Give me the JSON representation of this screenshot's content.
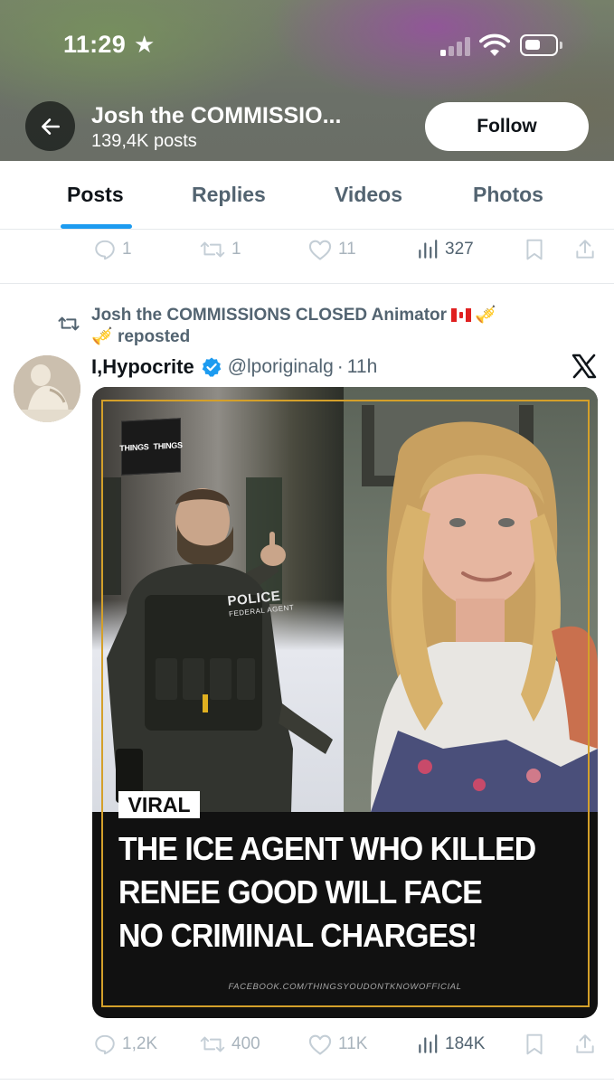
{
  "status_bar": {
    "time": "11:29",
    "star_glyph": "★"
  },
  "header": {
    "name": "Josh the COMMISSIO...",
    "post_count": "139,4K posts",
    "follow_label": "Follow",
    "back_icon": "arrow-left-icon"
  },
  "tabs": [
    {
      "label": "Posts",
      "active": true
    },
    {
      "label": "Replies",
      "active": false
    },
    {
      "label": "Videos",
      "active": false
    },
    {
      "label": "Photos",
      "active": false
    }
  ],
  "previous_post_actions": {
    "replies": "1",
    "reposts": "1",
    "likes": "11",
    "views": "327"
  },
  "post": {
    "repost_by": "Josh the COMMISSIONS CLOSED Animator",
    "repost_suffix": "reposted",
    "author_name": "I,Hypocrite",
    "author_handle": "@lporiginalg",
    "time_sep": "·",
    "time_ago": "11h",
    "verified_color": "#1d9bf0",
    "media": {
      "brand_text_1": "THINGS",
      "brand_text_2": "THINGS",
      "badge_text": "POLICE",
      "badge_sub": "FEDERAL AGENT",
      "tag": "VIRAL",
      "headline_lines": [
        "THE ICE AGENT WHO KILLED",
        "RENEE GOOD WILL FACE",
        "NO CRIMINAL CHARGES!"
      ],
      "credit": "FACEBOOK.COM/THINGSYOUDONTKNOWOFFICIAL",
      "frame_color": "#d4a02a"
    },
    "actions": {
      "replies": "1,2K",
      "reposts": "400",
      "likes": "11K",
      "views": "184K"
    }
  },
  "colors": {
    "accent": "#1d9bf0",
    "muted": "#536471",
    "text": "#0f1419"
  }
}
